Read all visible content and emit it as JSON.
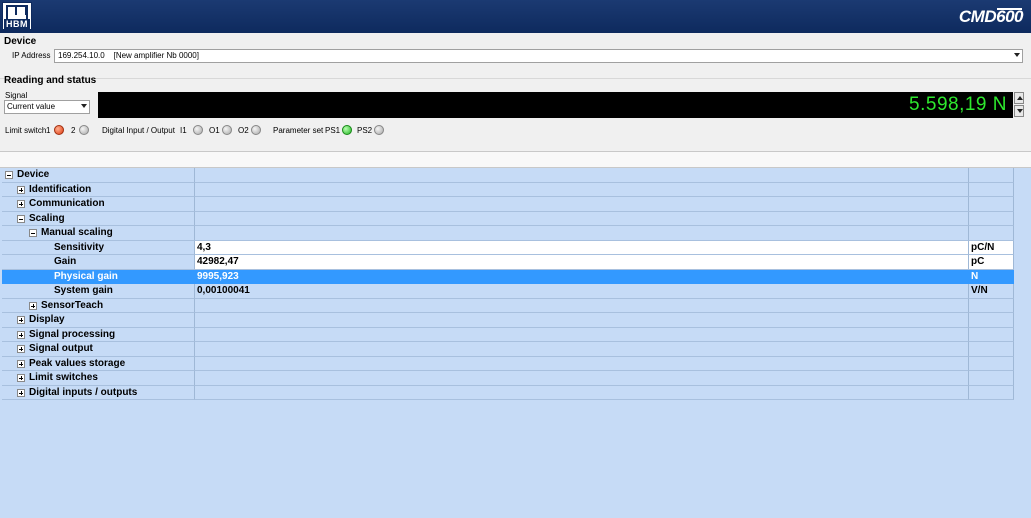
{
  "header": {
    "logo_text": "HBM",
    "brand_prefix": "CMD",
    "brand_number": "600"
  },
  "device": {
    "section_title": "Device",
    "ip_label": "IP Address",
    "ip_value": "169.254.10.0    [New amplifier Nb 0000]"
  },
  "reading": {
    "section_title": "Reading and status",
    "signal_label": "Signal",
    "signal_value": "Current value",
    "display_value": "5.598,19 N",
    "limit_switch_label": "Limit switch",
    "limit_1": "1",
    "limit_2": "2",
    "digital_label": "Digital Input / Output",
    "i1": "I1",
    "o1": "O1",
    "o2": "O2",
    "param_label": "Parameter set",
    "ps1": "PS1",
    "ps2": "PS2"
  },
  "tree": [
    {
      "label": "Device",
      "value": "",
      "unit": ""
    },
    {
      "label": "Identification",
      "value": "",
      "unit": ""
    },
    {
      "label": "Communication",
      "value": "",
      "unit": ""
    },
    {
      "label": "Scaling",
      "value": "",
      "unit": ""
    },
    {
      "label": "Manual scaling",
      "value": "",
      "unit": ""
    },
    {
      "label": "Sensitivity",
      "value": "4,3",
      "unit": "pC/N"
    },
    {
      "label": "Gain",
      "value": "42982,47",
      "unit": "pC"
    },
    {
      "label": "Physical gain",
      "value": "9995,923",
      "unit": "N"
    },
    {
      "label": "System gain",
      "value": "0,00100041",
      "unit": "V/N"
    },
    {
      "label": "SensorTeach",
      "value": "",
      "unit": ""
    },
    {
      "label": "Display",
      "value": "",
      "unit": ""
    },
    {
      "label": "Signal processing",
      "value": "",
      "unit": ""
    },
    {
      "label": "Signal output",
      "value": "",
      "unit": ""
    },
    {
      "label": "Peak values storage",
      "value": "",
      "unit": ""
    },
    {
      "label": "Limit switches",
      "value": "",
      "unit": ""
    },
    {
      "label": "Digital inputs / outputs",
      "value": "",
      "unit": ""
    }
  ]
}
